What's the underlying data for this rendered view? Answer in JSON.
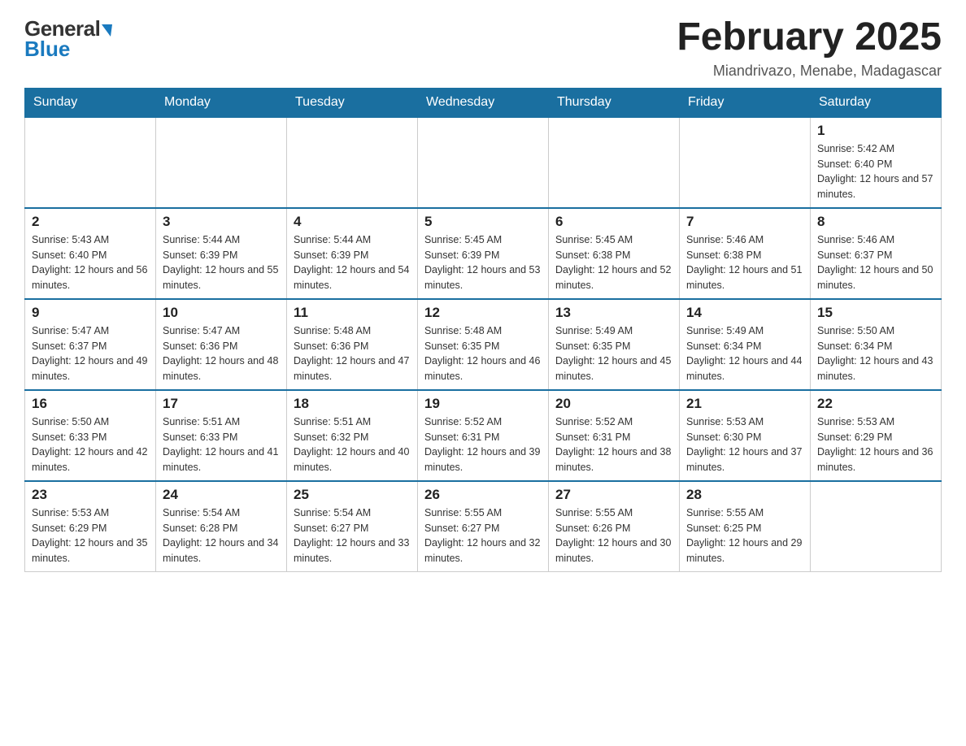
{
  "logo": {
    "text_general": "General",
    "text_blue": "Blue"
  },
  "title": "February 2025",
  "location": "Miandrivazo, Menabe, Madagascar",
  "weekdays": [
    "Sunday",
    "Monday",
    "Tuesday",
    "Wednesday",
    "Thursday",
    "Friday",
    "Saturday"
  ],
  "weeks": [
    [
      null,
      null,
      null,
      null,
      null,
      null,
      {
        "day": "1",
        "sunrise": "Sunrise: 5:42 AM",
        "sunset": "Sunset: 6:40 PM",
        "daylight": "Daylight: 12 hours and 57 minutes."
      }
    ],
    [
      {
        "day": "2",
        "sunrise": "Sunrise: 5:43 AM",
        "sunset": "Sunset: 6:40 PM",
        "daylight": "Daylight: 12 hours and 56 minutes."
      },
      {
        "day": "3",
        "sunrise": "Sunrise: 5:44 AM",
        "sunset": "Sunset: 6:39 PM",
        "daylight": "Daylight: 12 hours and 55 minutes."
      },
      {
        "day": "4",
        "sunrise": "Sunrise: 5:44 AM",
        "sunset": "Sunset: 6:39 PM",
        "daylight": "Daylight: 12 hours and 54 minutes."
      },
      {
        "day": "5",
        "sunrise": "Sunrise: 5:45 AM",
        "sunset": "Sunset: 6:39 PM",
        "daylight": "Daylight: 12 hours and 53 minutes."
      },
      {
        "day": "6",
        "sunrise": "Sunrise: 5:45 AM",
        "sunset": "Sunset: 6:38 PM",
        "daylight": "Daylight: 12 hours and 52 minutes."
      },
      {
        "day": "7",
        "sunrise": "Sunrise: 5:46 AM",
        "sunset": "Sunset: 6:38 PM",
        "daylight": "Daylight: 12 hours and 51 minutes."
      },
      {
        "day": "8",
        "sunrise": "Sunrise: 5:46 AM",
        "sunset": "Sunset: 6:37 PM",
        "daylight": "Daylight: 12 hours and 50 minutes."
      }
    ],
    [
      {
        "day": "9",
        "sunrise": "Sunrise: 5:47 AM",
        "sunset": "Sunset: 6:37 PM",
        "daylight": "Daylight: 12 hours and 49 minutes."
      },
      {
        "day": "10",
        "sunrise": "Sunrise: 5:47 AM",
        "sunset": "Sunset: 6:36 PM",
        "daylight": "Daylight: 12 hours and 48 minutes."
      },
      {
        "day": "11",
        "sunrise": "Sunrise: 5:48 AM",
        "sunset": "Sunset: 6:36 PM",
        "daylight": "Daylight: 12 hours and 47 minutes."
      },
      {
        "day": "12",
        "sunrise": "Sunrise: 5:48 AM",
        "sunset": "Sunset: 6:35 PM",
        "daylight": "Daylight: 12 hours and 46 minutes."
      },
      {
        "day": "13",
        "sunrise": "Sunrise: 5:49 AM",
        "sunset": "Sunset: 6:35 PM",
        "daylight": "Daylight: 12 hours and 45 minutes."
      },
      {
        "day": "14",
        "sunrise": "Sunrise: 5:49 AM",
        "sunset": "Sunset: 6:34 PM",
        "daylight": "Daylight: 12 hours and 44 minutes."
      },
      {
        "day": "15",
        "sunrise": "Sunrise: 5:50 AM",
        "sunset": "Sunset: 6:34 PM",
        "daylight": "Daylight: 12 hours and 43 minutes."
      }
    ],
    [
      {
        "day": "16",
        "sunrise": "Sunrise: 5:50 AM",
        "sunset": "Sunset: 6:33 PM",
        "daylight": "Daylight: 12 hours and 42 minutes."
      },
      {
        "day": "17",
        "sunrise": "Sunrise: 5:51 AM",
        "sunset": "Sunset: 6:33 PM",
        "daylight": "Daylight: 12 hours and 41 minutes."
      },
      {
        "day": "18",
        "sunrise": "Sunrise: 5:51 AM",
        "sunset": "Sunset: 6:32 PM",
        "daylight": "Daylight: 12 hours and 40 minutes."
      },
      {
        "day": "19",
        "sunrise": "Sunrise: 5:52 AM",
        "sunset": "Sunset: 6:31 PM",
        "daylight": "Daylight: 12 hours and 39 minutes."
      },
      {
        "day": "20",
        "sunrise": "Sunrise: 5:52 AM",
        "sunset": "Sunset: 6:31 PM",
        "daylight": "Daylight: 12 hours and 38 minutes."
      },
      {
        "day": "21",
        "sunrise": "Sunrise: 5:53 AM",
        "sunset": "Sunset: 6:30 PM",
        "daylight": "Daylight: 12 hours and 37 minutes."
      },
      {
        "day": "22",
        "sunrise": "Sunrise: 5:53 AM",
        "sunset": "Sunset: 6:29 PM",
        "daylight": "Daylight: 12 hours and 36 minutes."
      }
    ],
    [
      {
        "day": "23",
        "sunrise": "Sunrise: 5:53 AM",
        "sunset": "Sunset: 6:29 PM",
        "daylight": "Daylight: 12 hours and 35 minutes."
      },
      {
        "day": "24",
        "sunrise": "Sunrise: 5:54 AM",
        "sunset": "Sunset: 6:28 PM",
        "daylight": "Daylight: 12 hours and 34 minutes."
      },
      {
        "day": "25",
        "sunrise": "Sunrise: 5:54 AM",
        "sunset": "Sunset: 6:27 PM",
        "daylight": "Daylight: 12 hours and 33 minutes."
      },
      {
        "day": "26",
        "sunrise": "Sunrise: 5:55 AM",
        "sunset": "Sunset: 6:27 PM",
        "daylight": "Daylight: 12 hours and 32 minutes."
      },
      {
        "day": "27",
        "sunrise": "Sunrise: 5:55 AM",
        "sunset": "Sunset: 6:26 PM",
        "daylight": "Daylight: 12 hours and 30 minutes."
      },
      {
        "day": "28",
        "sunrise": "Sunrise: 5:55 AM",
        "sunset": "Sunset: 6:25 PM",
        "daylight": "Daylight: 12 hours and 29 minutes."
      },
      null
    ]
  ]
}
